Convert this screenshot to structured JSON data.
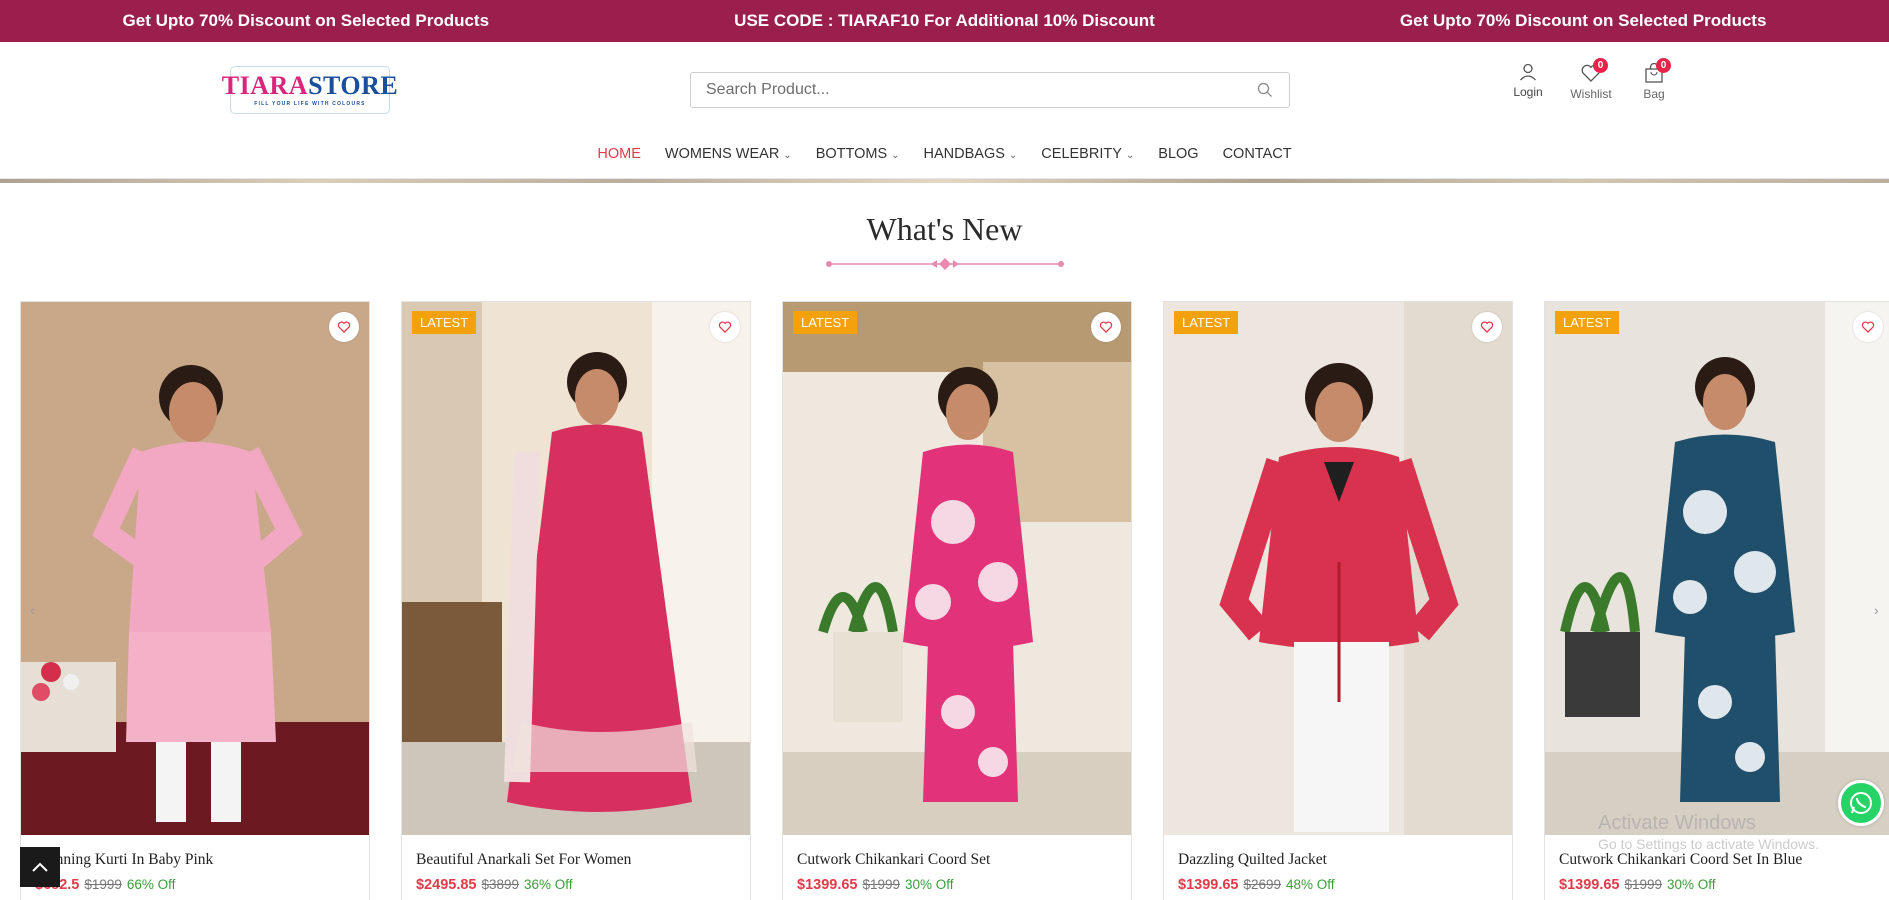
{
  "promo": {
    "left": "Get Upto 70% Discount on Selected Products",
    "center": "USE CODE : TIARAF10 For Additional 10% Discount",
    "right": "Get Upto 70% Discount on Selected Products"
  },
  "logo": {
    "part1": "TIARA",
    "part2": "STORE",
    "tagline": "FILL YOUR LIFE WITH COLOURS"
  },
  "search": {
    "placeholder": "Search Product..."
  },
  "header_icons": {
    "login": "Login",
    "wishlist": "Wishlist",
    "wishlist_count": "0",
    "bag": "Bag",
    "bag_count": "0"
  },
  "nav": {
    "home": "HOME",
    "womens_wear": "WOMENS WEAR",
    "bottoms": "BOTTOMS",
    "handbags": "HANDBAGS",
    "celebrity": "CELEBRITY",
    "blog": "BLOG",
    "contact": "CONTACT"
  },
  "section_title": "What's New",
  "products": [
    {
      "tag": "",
      "name": "Stunning Kurti In Baby Pink",
      "price": "$682.5",
      "was": "$1999",
      "off": "66% Off"
    },
    {
      "tag": "LATEST",
      "name": "Beautiful Anarkali Set For Women",
      "price": "$2495.85",
      "was": "$3899",
      "off": "36% Off"
    },
    {
      "tag": "LATEST",
      "name": "Cutwork Chikankari Coord Set",
      "price": "$1399.65",
      "was": "$1999",
      "off": "30% Off"
    },
    {
      "tag": "LATEST",
      "name": "Dazzling Quilted Jacket",
      "price": "$1399.65",
      "was": "$2699",
      "off": "48% Off"
    },
    {
      "tag": "LATEST",
      "name": "Cutwork Chikankari Coord Set In Blue",
      "price": "$1399.65",
      "was": "$1999",
      "off": "30% Off"
    }
  ],
  "watermark": {
    "line1": "Activate Windows",
    "line2": "Go to Settings to activate Windows."
  },
  "colors": {
    "promo_bg": "#9b1f4d",
    "accent_red": "#e23a4a",
    "tag_orange": "#f3a20e",
    "discount_green": "#3a9d3a"
  }
}
